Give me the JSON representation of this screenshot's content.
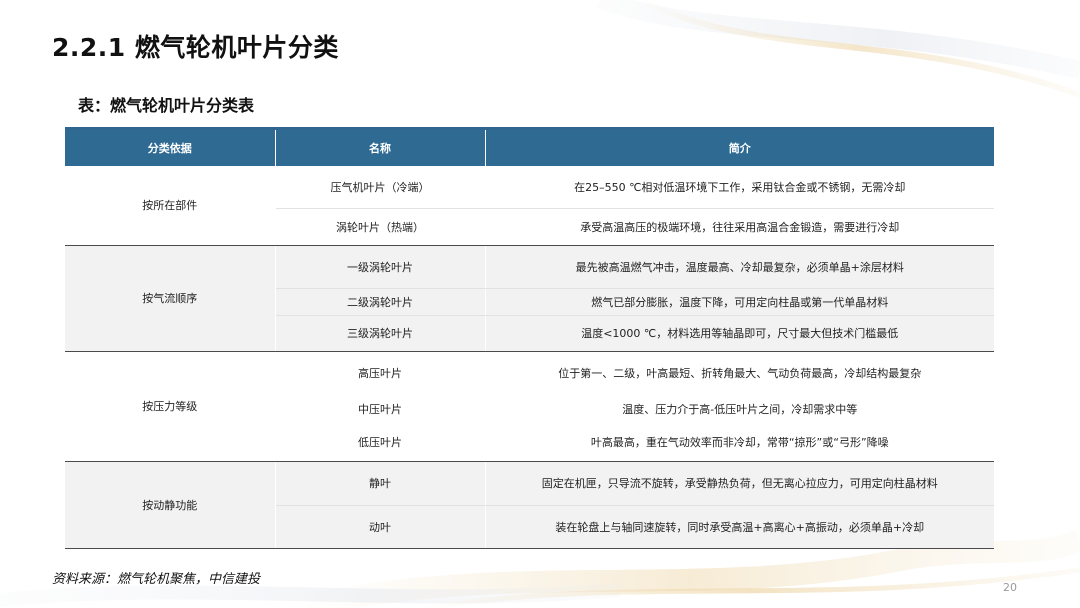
{
  "title": "2.2.1 燃气轮机叶片分类",
  "subtitle": "表：燃气轮机叶片分类表",
  "table": {
    "headers": [
      "分类依据",
      "名称",
      "简介"
    ],
    "groups": [
      {
        "category": "按所在部件",
        "rows": [
          {
            "name": "压气机叶片（冷端）",
            "desc": "在25–550 ℃相对低温环境下工作，采用钛合金或不锈钢，无需冷却"
          },
          {
            "name": "涡轮叶片（热端）",
            "desc": "承受高温高压的极端环境，往往采用高温合金锻造，需要进行冷却"
          }
        ]
      },
      {
        "category": "按气流顺序",
        "rows": [
          {
            "name": "一级涡轮叶片",
            "desc": "最先被高温燃气冲击，温度最高、冷却最复杂，必须单晶+涂层材料"
          },
          {
            "name": "二级涡轮叶片",
            "desc": "燃气已部分膨胀，温度下降，可用定向柱晶或第一代单晶材料"
          },
          {
            "name": "三级涡轮叶片",
            "desc": "温度<1000 ℃，材料选用等轴晶即可，尺寸最大但技术门槛最低"
          }
        ]
      },
      {
        "category": "按压力等级",
        "rows": [
          {
            "name": "高压叶片",
            "desc": "位于第一、二级，叶高最短、折转角最大、气动负荷最高，冷却结构最复杂"
          },
          {
            "name": "中压叶片",
            "desc": "温度、压力介于高-低压叶片之间，冷却需求中等"
          },
          {
            "name": "低压叶片",
            "desc": "叶高最高，重在气动效率而非冷却，常带“掠形”或“弓形”降噪"
          }
        ]
      },
      {
        "category": "按动静功能",
        "rows": [
          {
            "name": "静叶",
            "desc": "固定在机匣，只导流不旋转，承受静热负荷，但无离心拉应力，可用定向柱晶材料"
          },
          {
            "name": "动叶",
            "desc": "装在轮盘上与轴同速旋转，同时承受高温+高离心+高振动，必须单晶+冷却"
          }
        ]
      }
    ]
  },
  "source": "资料来源：燃气轮机聚焦，中信建投",
  "page_number": "20",
  "colors": {
    "header_bg": "#2f6a93",
    "shade_bg": "#f2f2f2",
    "accent_gold": "#e8cfa0"
  }
}
